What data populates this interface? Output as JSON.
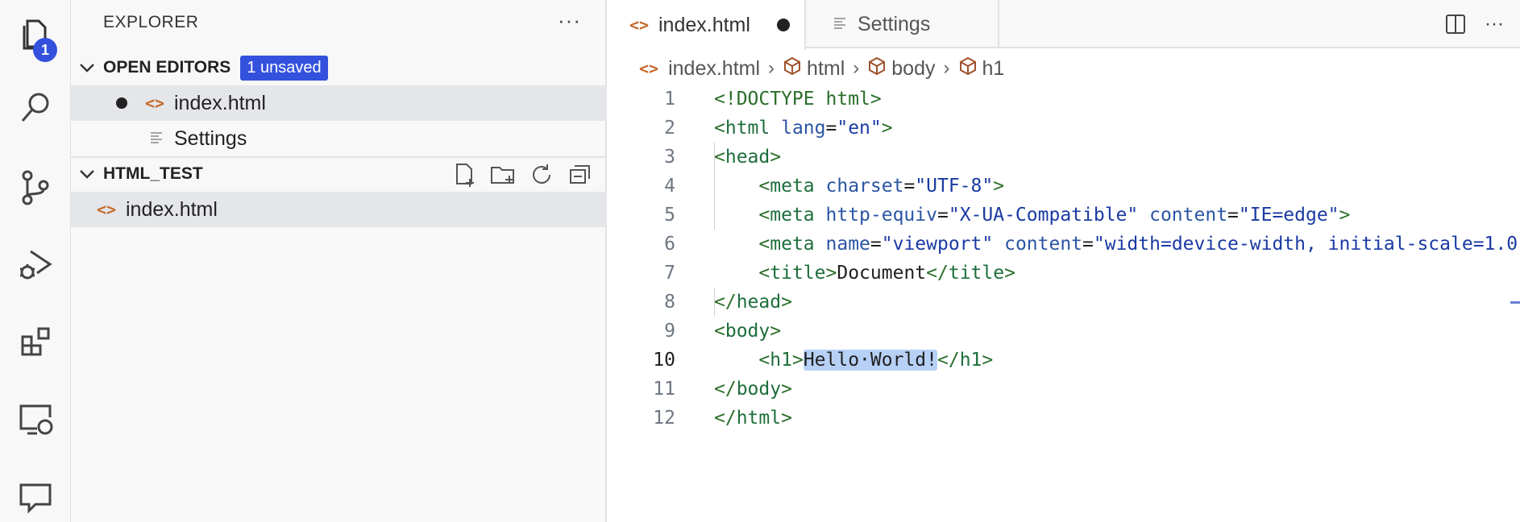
{
  "activity_bar": {
    "explorer_badge": "1",
    "items": [
      "explorer-icon",
      "search-icon",
      "source-control-icon",
      "run-debug-icon",
      "extensions-icon",
      "remote-explorer-icon",
      "comments-icon"
    ]
  },
  "sidebar": {
    "title": "EXPLORER",
    "more": "···",
    "open_editors": {
      "label": "OPEN EDITORS",
      "badge": "1 unsaved",
      "items": [
        {
          "label": "index.html",
          "icon": "html-file-icon",
          "unsaved": true
        },
        {
          "label": "Settings",
          "icon": "settings-file-icon",
          "unsaved": false
        }
      ]
    },
    "folder": {
      "label": "HTML_TEST",
      "files": [
        {
          "label": "index.html",
          "icon": "html-file-icon"
        }
      ]
    }
  },
  "editor": {
    "tabs": [
      {
        "label": "index.html",
        "unsaved": true
      },
      {
        "label": "Settings"
      }
    ],
    "breadcrumbs": [
      "index.html",
      "html",
      "body",
      "h1"
    ],
    "current_line": 10,
    "lines": [
      {
        "n": "1"
      },
      {
        "n": "2"
      },
      {
        "n": "3"
      },
      {
        "n": "4"
      },
      {
        "n": "5"
      },
      {
        "n": "6"
      },
      {
        "n": "7"
      },
      {
        "n": "8"
      },
      {
        "n": "9"
      },
      {
        "n": "10"
      },
      {
        "n": "11"
      },
      {
        "n": "12"
      }
    ],
    "code": {
      "l1": "<!DOCTYPE html>",
      "l2_tag": "html",
      "l2_attr": "lang",
      "l2_val": "\"en\"",
      "l3": "head",
      "l4_tag": "meta",
      "l4_attr": "charset",
      "l4_val": "\"UTF-8\"",
      "l5_tag": "meta",
      "l5_attr1": "http-equiv",
      "l5_val1": "\"X-UA-Compatible\"",
      "l5_attr2": "content",
      "l5_val2": "\"IE=edge\"",
      "l6_tag": "meta",
      "l6_attr1": "name",
      "l6_val1": "\"viewport\"",
      "l6_attr2": "content",
      "l6_val2": "\"width=device-width, initial-scale=1.0\"",
      "l7_tag": "title",
      "l7_text": "Document",
      "l8": "head",
      "l9": "body",
      "l10_tag": "h1",
      "l10_text": "Hello·World!",
      "l11": "body",
      "l12": "html"
    }
  }
}
